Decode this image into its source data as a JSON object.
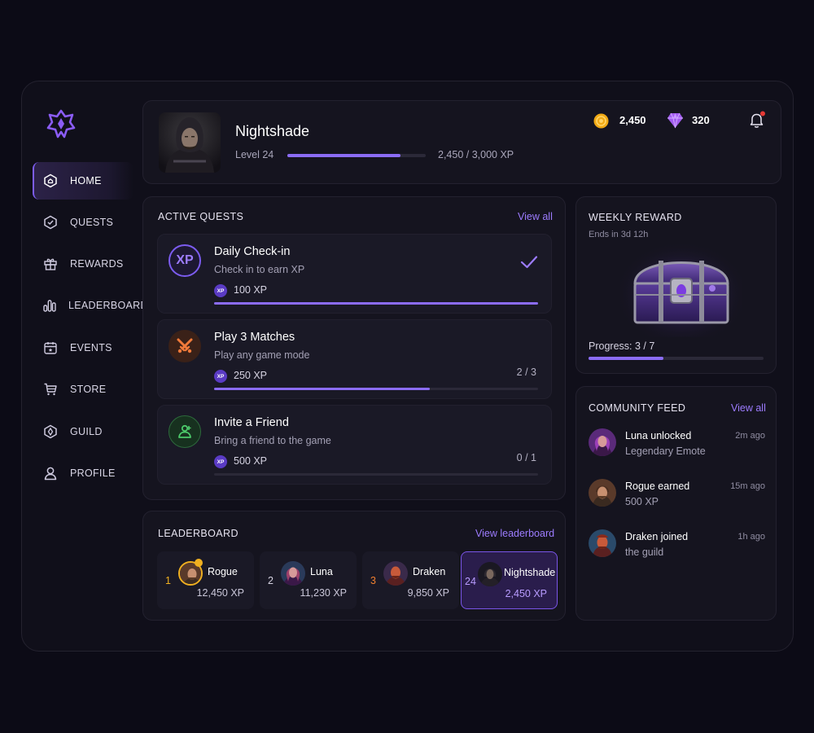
{
  "player": {
    "name": "Nightshade",
    "level": "Level 24",
    "xp_text": "2,450 / 3,000 XP",
    "xp_fraction": 0.82
  },
  "currency": {
    "coins": "2,450",
    "gems": "320"
  },
  "sidebar": {
    "items": [
      {
        "label": "HOME",
        "icon": "home-icon",
        "active": true
      },
      {
        "label": "QUESTS",
        "icon": "quests-icon"
      },
      {
        "label": "REWARDS",
        "icon": "gift-icon"
      },
      {
        "label": "LEADERBOARD",
        "icon": "bar-chart-icon"
      },
      {
        "label": "EVENTS",
        "icon": "calendar-icon"
      },
      {
        "label": "STORE",
        "icon": "cart-icon"
      },
      {
        "label": "GUILD",
        "icon": "shield-icon"
      },
      {
        "label": "PROFILE",
        "icon": "user-icon"
      }
    ]
  },
  "quests": {
    "title": "ACTIVE QUESTS",
    "view_all": "View all",
    "items": [
      {
        "title": "Daily Check-in",
        "subtitle": "Check in to earn XP",
        "xp": "100 XP",
        "badge": "XP",
        "icon_text": "XP",
        "progress": "",
        "fraction": 1.0,
        "completed": true
      },
      {
        "title": "Play 3 Matches",
        "subtitle": "Play any game mode",
        "xp": "250 XP",
        "badge": "XP",
        "progress": "2 / 3",
        "fraction": 0.667
      },
      {
        "title": "Invite a Friend",
        "subtitle": "Bring a friend to the game",
        "xp": "500 XP",
        "badge": "XP",
        "progress": "0 / 1",
        "fraction": 0
      }
    ]
  },
  "weekly_reward": {
    "title": "WEEKLY REWARD",
    "ends": "Ends in 3d 12h",
    "progress_text": "Progress: 3 / 7",
    "fraction": 0.43
  },
  "leaderboard": {
    "title": "LEADERBOARD",
    "view": "View leaderboard",
    "entries": [
      {
        "rank": "1",
        "name": "Rogue",
        "xp": "12,450 XP"
      },
      {
        "rank": "2",
        "name": "Luna",
        "xp": "11,230 XP"
      },
      {
        "rank": "3",
        "name": "Draken",
        "xp": "9,850 XP"
      },
      {
        "rank": "24",
        "name": "Nightshade",
        "xp": "2,450 XP"
      }
    ]
  },
  "feed": {
    "title": "COMMUNITY FEED",
    "view_all": "View all",
    "items": [
      {
        "line1": "Luna unlocked",
        "line2": "Legendary Emote",
        "time": "2m ago"
      },
      {
        "line1": "Rogue earned",
        "line2": "500 XP",
        "time": "15m ago"
      },
      {
        "line1": "Draken joined",
        "line2": "the guild",
        "time": "1h ago"
      }
    ]
  },
  "colors": {
    "accent": "#8b6cf6",
    "background": "#0c0b16",
    "panel": "#15141f",
    "gold": "#f0b020",
    "bronze": "#f08030",
    "notification": "#e53935"
  }
}
